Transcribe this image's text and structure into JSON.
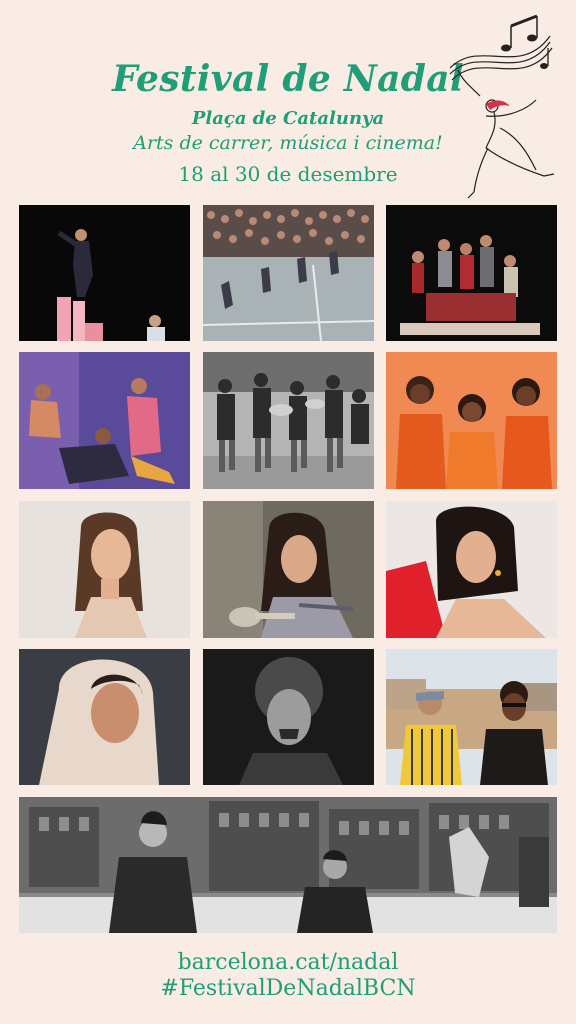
{
  "header": {
    "title": "Festival de Nadal",
    "subtitle": "Plaça de Catalunya",
    "tagline": "Arts de carrer, música i cinema!",
    "dates": "18 al 30 de desembre"
  },
  "footer": {
    "website": "barcelona.cat/nadal",
    "hashtag": "#FestivalDeNadalBCN"
  },
  "colors": {
    "brand": "#1f9e78",
    "background": "#f8ece4",
    "accent": "#d6304a"
  },
  "icons": [
    "music-notes-icon",
    "dancer-illustration"
  ]
}
